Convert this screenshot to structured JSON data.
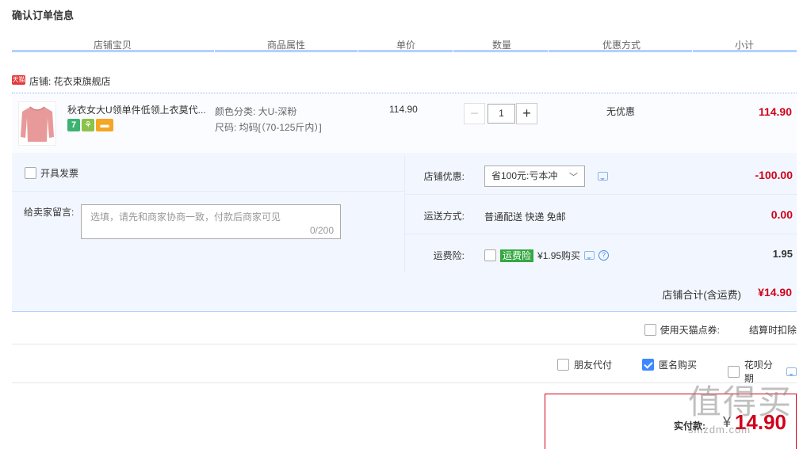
{
  "page": {
    "title": "确认订单信息"
  },
  "table_header": [
    "店铺宝贝",
    "商品属性",
    "单价",
    "数量",
    "优惠方式",
    "小计"
  ],
  "shop": {
    "badge": "天猫",
    "label": "店铺: 花衣束旗舰店"
  },
  "item": {
    "name": "秋衣女大U领单件低领上衣莫代...",
    "badges": [
      {
        "text": "7",
        "color": "#3cb371"
      },
      {
        "text": "",
        "color": "#8bc34a"
      },
      {
        "text": "",
        "color": "#f5a623"
      }
    ],
    "attr_color": "颜色分类: 大U-深粉",
    "attr_size": "尺码: 均码[（70-125斤内）]",
    "unit_price": "114.90",
    "quantity": "1",
    "minus": "−",
    "plus": "+",
    "discount": "无优惠",
    "subtotal": "114.90"
  },
  "invoice": {
    "label": "开具发票"
  },
  "message": {
    "label": "给卖家留言:",
    "placeholder": "选填，请先和商家协商一致，付款后商家可见",
    "counter": "0/200"
  },
  "shop_discount": {
    "label": "店铺优惠:",
    "selected": "省100元:亏本冲",
    "value": "-100.00"
  },
  "shipping": {
    "label": "运送方式:",
    "text": "普通配送 快递 免邮",
    "value": "0.00"
  },
  "insurance": {
    "label": "运费险:",
    "badge": "运费险",
    "text": "¥1.95购买",
    "value": "1.95",
    "help": "?"
  },
  "shop_total": {
    "label": "店铺合计(含运费)",
    "value": "¥14.90"
  },
  "coupon": {
    "label": "使用天猫点券:",
    "note": "结算时扣除"
  },
  "options": [
    {
      "label": "朋友代付",
      "checked": false
    },
    {
      "label": "匿名购买",
      "checked": true
    },
    {
      "label": "花呗分期",
      "checked": false
    }
  ],
  "payment": {
    "label": "实付款:",
    "currency": "¥",
    "value": "14.90"
  },
  "watermark": {
    "main": "值得买",
    "sub": "smzdm.com"
  },
  "colors": {
    "accent_red": "#d0021b",
    "border_blue": "#b2d1ff",
    "panel_bg": "#f2f7ff"
  }
}
